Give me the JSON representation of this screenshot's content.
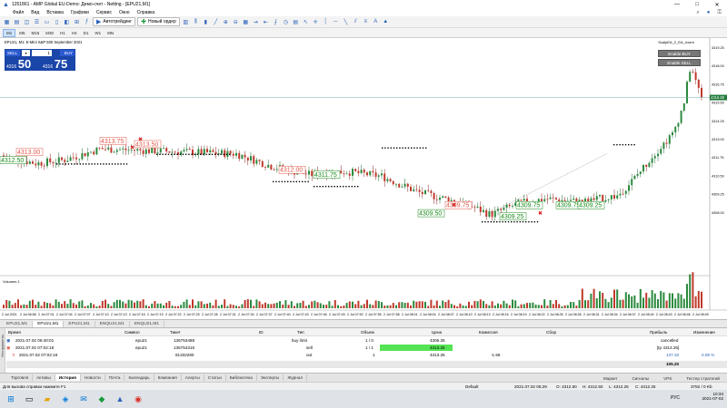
{
  "window": {
    "title": "1251861 - AMP Global EU-Demo: Демо-счет - Netting - [EPU21,M1]",
    "controls": [
      "—",
      "□",
      "✕"
    ]
  },
  "menu": [
    "Файл",
    "Вид",
    "Вставка",
    "Графики",
    "Сервис",
    "Окно",
    "Справка"
  ],
  "toolbar": {
    "algo_label": "Автотрейдинг",
    "new_order_label": "Новый ордер"
  },
  "timeframes": [
    "M1",
    "M5",
    "M15",
    "M30",
    "H1",
    "H4",
    "D1",
    "W1",
    "MN"
  ],
  "chart": {
    "symbol_title": "EPU21, M1: E-Mini S&P 500 September 2021",
    "ea_name": "ScalpEA_2_EA_Ivorre",
    "enable_buy": "Enable BUY",
    "enable_sell": "Enable SELL",
    "volume_label": "Volumes 1",
    "last_price": "4316.50",
    "price_ticks": [
      "4319.25",
      "4318.00",
      "4316.75",
      "4315.50",
      "4314.25",
      "4313.00",
      "4311.75",
      "4310.50",
      "4309.25",
      "4308.00"
    ],
    "time_ticks": [
      "2 Jul 2021",
      "2 Jul 06:58",
      "2 Jul 07:01",
      "2 Jul 07:04",
      "2 Jul 07:07",
      "2 Jul 07:10",
      "2 Jul 07:13",
      "2 Jul 07:16",
      "2 Jul 07:19",
      "2 Jul 07:22",
      "2 Jul 07:25",
      "2 Jul 07:28",
      "2 Jul 07:31",
      "2 Jul 07:34",
      "2 Jul 07:37",
      "2 Jul 07:40",
      "2 Jul 07:43",
      "2 Jul 07:46",
      "2 Jul 07:49",
      "2 Jul 07:52",
      "2 Jul 07:55",
      "2 Jul 07:58",
      "2 Jul 08:01",
      "2 Jul 08:04",
      "2 Jul 08:07",
      "2 Jul 08:10",
      "2 Jul 08:13",
      "2 Jul 08:16",
      "2 Jul 08:19",
      "2 Jul 08:22",
      "2 Jul 08:25",
      "2 Jul 08:28",
      "2 Jul 08:31",
      "2 Jul 08:34",
      "2 Jul 08:37",
      "2 Jul 08:40",
      "2 Jul 08:43",
      "2 Jul 08:46",
      "2 Jul 08:49"
    ],
    "labels": [
      {
        "text": "4312.50",
        "color": "#1a8a1a"
      },
      {
        "text": "4313.00",
        "color": "#e0584a"
      },
      {
        "text": "4313.75",
        "color": "#e0584a"
      },
      {
        "text": "4313.50",
        "color": "#e0584a"
      },
      {
        "text": "4312.00",
        "color": "#e0584a"
      },
      {
        "text": "4311.75",
        "color": "#1a8a1a"
      },
      {
        "text": "4309.75",
        "color": "#e0584a"
      },
      {
        "text": "4309.50",
        "color": "#1a8a1a"
      },
      {
        "text": "4309.75",
        "color": "#1a8a1a"
      },
      {
        "text": "4309.25",
        "color": "#1a8a1a"
      },
      {
        "text": "4309.75",
        "color": "#1a8a1a"
      },
      {
        "text": "4309.25",
        "color": "#1a8a1a"
      }
    ]
  },
  "one_click": {
    "sell": "SELL",
    "buy": "BUY",
    "volume": "1",
    "sell_small": "4316",
    "sell_big": "50",
    "buy_small": "4316",
    "buy_big": "75"
  },
  "chart_tabs": [
    "EPU21,M1",
    "EPU21,M1",
    "EPU21,M1",
    "ENQU21,M1",
    "ENQU21,M1"
  ],
  "toolbox": {
    "side_label": "Инструменты",
    "headers": [
      "Время",
      "Символ",
      "Тикет",
      "ID",
      "Тип",
      "Объем",
      "Цена",
      "Комиссия",
      "Сбор",
      "Прибыль",
      "Изменение"
    ],
    "rows": [
      {
        "time": "2021.07.02 06:40:01",
        "symbol": "epu21",
        "ticket": "136753488",
        "type": "buy limit",
        "volume": "1 / 0",
        "price": "4306.25",
        "commission": "",
        "profit": "cancelled",
        "change": ""
      },
      {
        "time": "2021.07.02 07:02:18",
        "symbol": "epu21",
        "ticket": "136754316",
        "type": "sell",
        "volume": "1 / 1",
        "price": "4313.25",
        "commission": "",
        "profit": "[tp 4313.25]",
        "change": ""
      },
      {
        "time": "2021.07.02 07:02:18",
        "symbol": "",
        "ticket": "81332280",
        "type": "out",
        "volume": "1",
        "price": "4313.25",
        "commission": "-1.56",
        "profit": "137.33",
        "change": "0.08 %"
      }
    ],
    "total": "105.20"
  },
  "bottom_tabs": [
    "Торговля",
    "Активы",
    "История",
    "Новости",
    "Почта",
    "Календарь",
    "Компания",
    "Алерты",
    "Статьи",
    "Библиотека",
    "Эксперты",
    "Журнал"
  ],
  "bottom_active": "История",
  "bottom_right": [
    "Маркет",
    "Сигналы",
    "VPS",
    "Тестер стратегий"
  ],
  "status": {
    "help": "Для вызова справки нажмите F1",
    "profile": "Default",
    "datetime": "2021.07.02 05:29",
    "open": "O: 4312.50",
    "high": "H: 4312.50",
    "low": "L: 4312.25",
    "close": "C: 4312.25",
    "traffic": "3782 / 0 Kb"
  },
  "taskbar": {
    "lang": "РУС",
    "time": "10:34",
    "date": "2021-07-02"
  }
}
